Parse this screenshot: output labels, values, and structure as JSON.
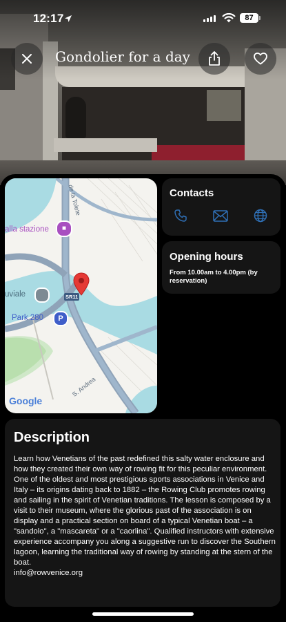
{
  "status_bar": {
    "time": "12:17",
    "battery": "87"
  },
  "header": {
    "title": "Gondolier for a day"
  },
  "map": {
    "labels": {
      "station": "alla stazione",
      "street_top": "de la Tolete",
      "area": "uviale",
      "parking": "Park 280",
      "route": "SR11",
      "street_bottom": "S. Andrea",
      "attribution": "Google"
    }
  },
  "contacts": {
    "title": "Contacts"
  },
  "opening_hours": {
    "title": "Opening hours",
    "text": "From 10.00am to 4.00pm (by reservation)"
  },
  "description": {
    "title": "Description",
    "body": "Learn how Venetians of the past redefined this salty water enclosure and how they created their own way of rowing fit for this peculiar environment. One of the oldest and most prestigious sports associations in Venice and Italy – its origins dating back to 1882 – the Rowing Club promotes rowing and sailing in the spirit of Venetian traditions. The lesson is composed by a visit to their museum, where the glorious past of the association is on display and a practical section on board of a typical Venetian boat – a \"sandolo\", a \"mascareta\" or a \"caorlina\". Qualified instructors with extensive experience accompany you along a suggestive run to discover the Southern lagoon, learning the traditional way of rowing by standing at the stern of the boat.",
    "email": "info@rowvenice.org"
  },
  "colors": {
    "accent": "#2f6fb5",
    "card": "#151515",
    "map_water": "#a9dbe3",
    "pin": "#e53935"
  }
}
